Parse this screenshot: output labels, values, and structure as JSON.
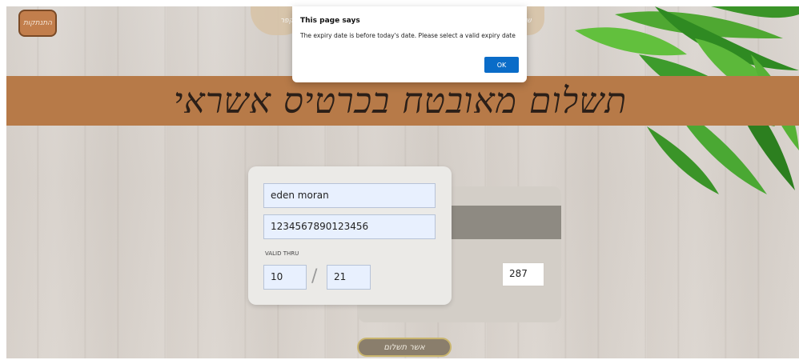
{
  "header": {
    "back_label": "התנתקות",
    "pill_label": "ר קפר",
    "pill_right_label": "ש"
  },
  "banner": {
    "title": "תשלום מאובטח בכרטיס אשראי"
  },
  "card": {
    "name_value": "eden moran",
    "number_value": "1234567890123456",
    "valid_thru_label": "VALID THRU",
    "month_value": "10",
    "slash": "/",
    "year_value": "21",
    "cvv_value": "287"
  },
  "footer": {
    "pay_label": "אשר תשלום"
  },
  "dialog": {
    "title": "This page says",
    "message": "The expiry date is before today's date. Please select a valid expiry date",
    "ok_label": "OK"
  },
  "colors": {
    "banner": "#b77a48",
    "back_button": "#c27e4c",
    "ok_button": "#0a6cc8",
    "field_fill": "#e8f0fe"
  }
}
